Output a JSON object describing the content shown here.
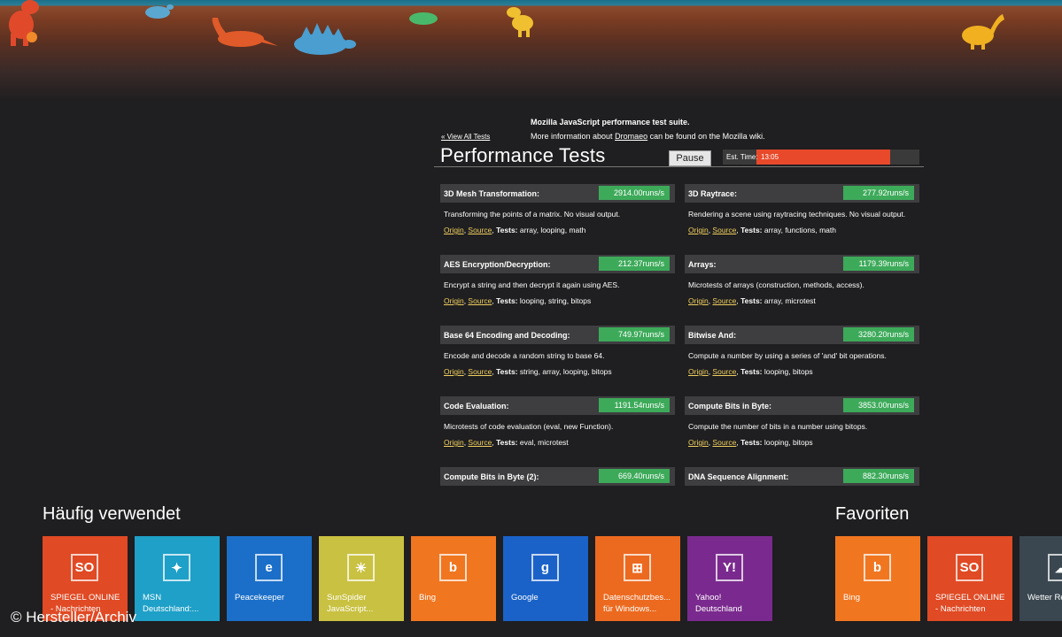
{
  "header": {
    "suite_title": "Mozilla JavaScript performance test suite.",
    "more_info_prefix": "More information about",
    "more_info_link": "Dromaeo",
    "more_info_suffix": "can be found on the Mozilla wiki.",
    "view_all": "« View All Tests",
    "page_title": "Performance Tests",
    "pause_label": "Pause",
    "est_label": "Est. Time:",
    "est_time": "13:05",
    "est_progress": 0.82
  },
  "tests": [
    {
      "name": "3D Mesh Transformation:",
      "value": "2914.00runs/s",
      "desc": "Transforming the points of a matrix. No visual output.",
      "tests": "array, looping, math"
    },
    {
      "name": "3D Raytrace:",
      "value": "277.92runs/s",
      "desc": "Rendering a scene using raytracing techniques. No visual output.",
      "tests": "array, functions, math"
    },
    {
      "name": "AES Encryption/Decryption:",
      "value": "212.37runs/s",
      "desc": "Encrypt a string and then decrypt it again using AES.",
      "tests": "looping, string, bitops"
    },
    {
      "name": "Arrays:",
      "value": "1179.39runs/s",
      "desc": "Microtests of arrays (construction, methods, access).",
      "tests": "array, microtest"
    },
    {
      "name": "Base 64 Encoding and Decoding:",
      "value": "749.97runs/s",
      "desc": "Encode and decode a random string to base 64.",
      "tests": "string, array, looping, bitops"
    },
    {
      "name": "Bitwise And:",
      "value": "3280.20runs/s",
      "desc": "Compute a number by using a series of 'and' bit operations.",
      "tests": "looping, bitops"
    },
    {
      "name": "Code Evaluation:",
      "value": "1191.54runs/s",
      "desc": "Microtests of code evaluation (eval, new Function).",
      "tests": "eval, microtest"
    },
    {
      "name": "Compute Bits in Byte:",
      "value": "3853.00runs/s",
      "desc": "Compute the number of bits in a number using bitops.",
      "tests": "looping, bitops"
    },
    {
      "name": "Compute Bits in Byte (2):",
      "value": "669.40runs/s"
    },
    {
      "name": "DNA Sequence Alignment:",
      "value": "882.30runs/s"
    }
  ],
  "labels": {
    "origin": "Origin",
    "source": "Source",
    "tests": "Tests:"
  },
  "start": {
    "group1_title": "Häufig verwendet",
    "group2_title": "Favoriten",
    "tiles": [
      {
        "label": "SPIEGEL ONLINE - Nachrichten",
        "color": "#e04a24",
        "icon": "spiegel-icon",
        "glyph": "SO"
      },
      {
        "label": "MSN Deutschland:...",
        "color": "#1ea0c8",
        "icon": "msn-icon",
        "glyph": "✦"
      },
      {
        "label": "Peacekeeper",
        "color": "#1b6fc9",
        "icon": "ie-icon",
        "glyph": "e"
      },
      {
        "label": "SunSpider JavaScript...",
        "color": "#c9c141",
        "icon": "sunspider-icon",
        "glyph": "☀"
      },
      {
        "label": "Bing",
        "color": "#f07620",
        "icon": "bing-icon",
        "glyph": "b"
      },
      {
        "label": "Google",
        "color": "#1a62c8",
        "icon": "google-icon",
        "glyph": "g"
      },
      {
        "label": "Datenschutzbes... für Windows...",
        "color": "#ec6a1f",
        "icon": "windows-icon",
        "glyph": "⊞"
      },
      {
        "label": "Yahoo! Deutschland",
        "color": "#7a2a8e",
        "icon": "yahoo-icon",
        "glyph": "Y!"
      },
      {
        "label": "Bing",
        "color": "#f07620",
        "icon": "bing-icon",
        "glyph": "b"
      },
      {
        "label": "SPIEGEL ONLINE - Nachrichten",
        "color": "#e04a24",
        "icon": "spiegel-icon",
        "glyph": "SO"
      },
      {
        "label": "Wetter Regione",
        "color": "#3a4750",
        "icon": "weather-icon",
        "glyph": "☁"
      }
    ]
  },
  "copyright": "© Hersteller/Archiv"
}
